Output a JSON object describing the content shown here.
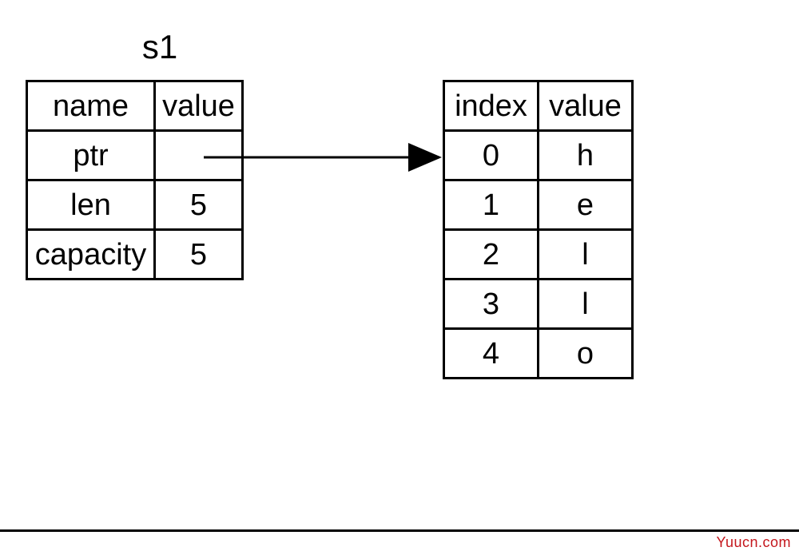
{
  "title": "s1",
  "left_table": {
    "headers": [
      "name",
      "value"
    ],
    "rows": [
      {
        "name": "ptr",
        "value": ""
      },
      {
        "name": "len",
        "value": "5"
      },
      {
        "name": "capacity",
        "value": "5"
      }
    ]
  },
  "right_table": {
    "headers": [
      "index",
      "value"
    ],
    "rows": [
      {
        "index": "0",
        "value": "h"
      },
      {
        "index": "1",
        "value": "e"
      },
      {
        "index": "2",
        "value": "l"
      },
      {
        "index": "3",
        "value": "l"
      },
      {
        "index": "4",
        "value": "o"
      }
    ]
  },
  "watermark": "Yuucn.com",
  "chart_data": {
    "type": "table",
    "description": "Memory layout diagram of a string struct 's1' pointing to heap data 'hello'",
    "struct": {
      "name": "s1",
      "ptr": "→heap",
      "len": 5,
      "capacity": 5
    },
    "heap": [
      {
        "index": 0,
        "value": "h"
      },
      {
        "index": 1,
        "value": "e"
      },
      {
        "index": 2,
        "value": "l"
      },
      {
        "index": 3,
        "value": "l"
      },
      {
        "index": 4,
        "value": "o"
      }
    ]
  }
}
